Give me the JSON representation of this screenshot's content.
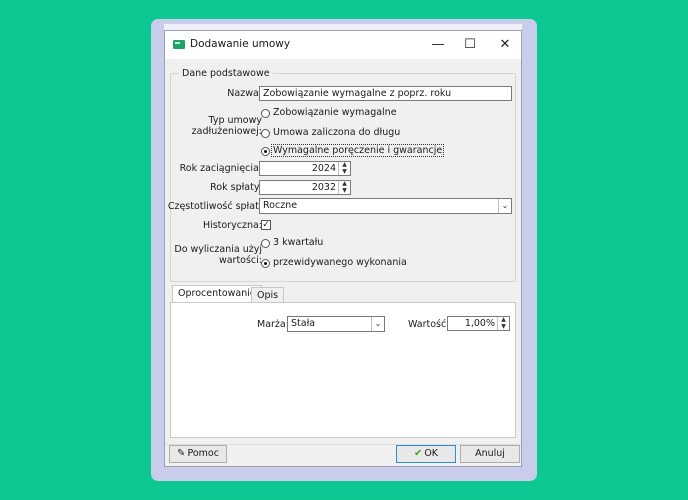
{
  "window": {
    "title": "Dodawanie umowy",
    "minimize_glyph": "—",
    "maximize_glyph": "☐",
    "close_glyph": "✕"
  },
  "group": {
    "legend": "Dane podstawowe",
    "name_label": "Nazwa:",
    "name_value": "Zobowiązanie wymagalne z poprz. roku",
    "type_label": "Typ umowy zadłużeniowej:",
    "type_options": [
      "Zobowiązanie wymagalne",
      "Umowa zaliczona do długu",
      "Wymagalne poręczenie i gwarancje"
    ],
    "type_selected": 2,
    "year_taken_label": "Rok zaciągnięcia:",
    "year_taken_value": "2024",
    "year_repaid_label": "Rok spłaty:",
    "year_repaid_value": "2032",
    "frequency_label": "Częstotliwość spłat:",
    "frequency_value": "Roczne",
    "historical_label": "Historyczna:",
    "historical_checked": true,
    "calc_label": "Do wyliczania użyj wartości:",
    "calc_options": [
      "3 kwartału",
      "przewidywanego wykonania"
    ],
    "calc_selected": 1
  },
  "tabs": [
    {
      "label": "Oprocentowanie",
      "active": true
    },
    {
      "label": "Opis",
      "active": false
    }
  ],
  "interest": {
    "margin_label": "Marża:",
    "margin_value": "Stała",
    "value_label": "Wartość:",
    "value_value": "1,00%"
  },
  "buttons": {
    "help": "Pomoc",
    "ok": "OK",
    "cancel": "Anuluj"
  },
  "icons": {
    "spin_up": "▲",
    "spin_down": "▼",
    "dropdown": "⌄",
    "check": "✓",
    "ok_check": "✔",
    "help": "✎"
  },
  "colors": {
    "background": "#0cc893",
    "ok_icon": "#3aa832",
    "accent": "#2a8fd8"
  }
}
